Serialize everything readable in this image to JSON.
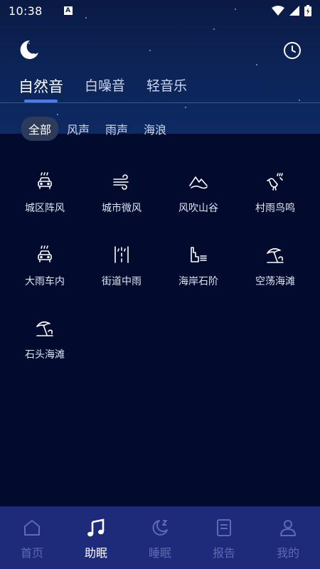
{
  "status_bar": {
    "time": "10:38",
    "notification_letter": "A"
  },
  "tabs": [
    {
      "label": "自然音",
      "active": true
    },
    {
      "label": "白噪音",
      "active": false
    },
    {
      "label": "轻音乐",
      "active": false
    }
  ],
  "chips": [
    {
      "label": "全部",
      "active": true
    },
    {
      "label": "风声",
      "active": false
    },
    {
      "label": "雨声",
      "active": false
    },
    {
      "label": "海浪",
      "active": false
    }
  ],
  "sounds": [
    {
      "label": "城区阵风",
      "icon": "car-rain-icon"
    },
    {
      "label": "城市微风",
      "icon": "wind-icon"
    },
    {
      "label": "风吹山谷",
      "icon": "mountain-icon"
    },
    {
      "label": "村雨鸟鸣",
      "icon": "bird-rain-icon"
    },
    {
      "label": "大雨车内",
      "icon": "car-rain-icon"
    },
    {
      "label": "街道中雨",
      "icon": "street-rain-icon"
    },
    {
      "label": "海岸石阶",
      "icon": "stairs-icon"
    },
    {
      "label": "空荡海滩",
      "icon": "beach-umbrella-icon"
    },
    {
      "label": "石头海滩",
      "icon": "beach-umbrella-icon"
    }
  ],
  "bottom_nav": [
    {
      "label": "首页",
      "icon": "home-icon",
      "active": false
    },
    {
      "label": "助眠",
      "icon": "music-note-icon",
      "active": true
    },
    {
      "label": "睡眠",
      "icon": "moon-zz-icon",
      "active": false
    },
    {
      "label": "报告",
      "icon": "report-icon",
      "active": false
    },
    {
      "label": "我的",
      "icon": "user-icon",
      "active": false
    }
  ],
  "colors": {
    "accent": "#4a7cf0",
    "background": "#020a2e",
    "nav_background": "#1e2a7a",
    "nav_inactive": "#5f6bb0"
  }
}
